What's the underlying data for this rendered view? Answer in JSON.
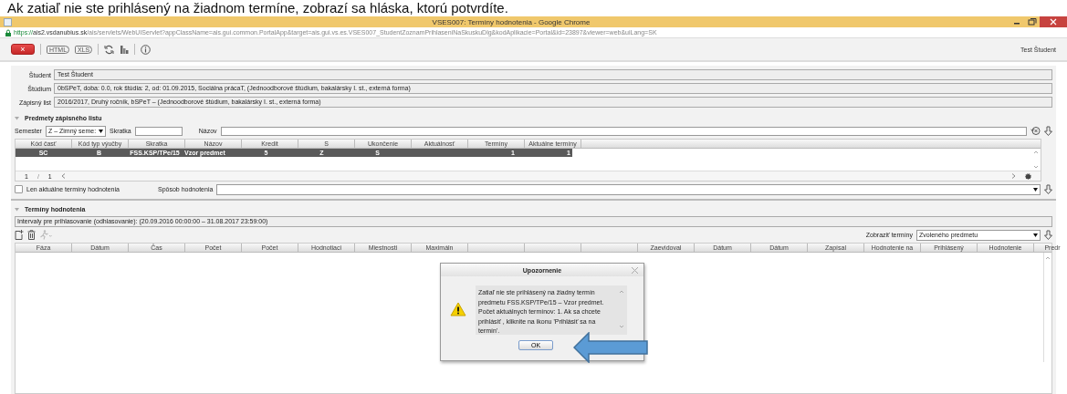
{
  "caption": "Ak zatiaľ nie ste prihlásený na žiadnom termíne, zobrazí sa hláska, ktorú potvrdíte.",
  "window": {
    "title": "VSES007: Termíny hodnotenia - Google Chrome"
  },
  "address": {
    "scheme": "https://",
    "host": "ais2.vsdanubius.sk",
    "path": "/ais/servlets/WebUIServlet?appClassName=ais.gui.common.PortalApp&target=ais.gui.vs.es.VSES007_StudentZoznamPrihlaseniNaSkuskuDlg&kodAplikacie=Portal&id=23897&viewer=web&uiLang=SK"
  },
  "toolbar": {
    "close": "×",
    "export_html": "HTML",
    "export_xls": "XLS",
    "user": "Test Študent"
  },
  "form": [
    {
      "label": "Študent",
      "value": "Test Študent"
    },
    {
      "label": "Štúdium",
      "value": "0bSPeT, doba: 0.0, rok štúdia: 2, od: 01.09.2015, Sociálna prácaT, (Jednoodborové štúdium, bakalársky I. st., externá forma)"
    },
    {
      "label": "Zápisný list",
      "value": "2016/2017, Druhý ročník, bSPeT – (Jednoodborové štúdium, bakalársky I. st., externá forma)"
    }
  ],
  "subjects": {
    "title": "Predmety zápisného listu",
    "expanded": true,
    "filters": {
      "semester_label": "Semester",
      "semester": "Z – Zimný seme:",
      "abbr_label": "Skratka",
      "name_label": "Názov"
    },
    "columns": [
      "Kód časť",
      "Kód typ výučby",
      "Skratka",
      "Názov",
      "Kredit",
      "S",
      "Ukončenie",
      "Aktuálnosť",
      "Termíny",
      "Aktuálne termíny"
    ],
    "rows": [
      {
        "selected": true,
        "cells": [
          "SC",
          "B",
          "FSS.KSP/TPe/15",
          "Vzor predmet",
          "5",
          "Z",
          "S",
          null,
          "1",
          "1"
        ]
      }
    ],
    "pager": {
      "page": "1",
      "sep": "/",
      "total": "1"
    },
    "only_current": {
      "label": "Len aktuálne termíny hodnotenia",
      "checked": false
    },
    "method_label": "Spôsob hodnotenia"
  },
  "terms": {
    "title": "Termíny hodnotenia",
    "expanded": true,
    "interval": "Intervaly pre prihlasovanie (odhlasovanie): (20.09.2016 00:00:00 – 31.08.2017 23:59:00)",
    "show_label": "Zobraziť termíny",
    "show_value": "Zvoleného predmetu",
    "columns_left": [
      "Fáza",
      "Dátum",
      "Čas",
      "Počet",
      "Počet",
      "Hodnotiaci",
      "Miestnosti",
      "Maximáln"
    ],
    "columns_right": [
      "Zaevidoval",
      "Dátum",
      "Dátum",
      "Zapísal",
      "Hodnotenie na",
      "Prihlásený",
      "Hodnotenie",
      "Predr"
    ]
  },
  "dialog": {
    "title": "Upozornenie",
    "message": "Zatiaľ nie ste prihlásený na žiadny termín predmetu FSS.KSP/TPe/15 – Vzor predmet. Počet aktuálnych termínov: 1. Ak sa chcete prihlásiť , kliknite na ikonu 'Prihlásiť sa na termín'.",
    "ok": "OK"
  }
}
